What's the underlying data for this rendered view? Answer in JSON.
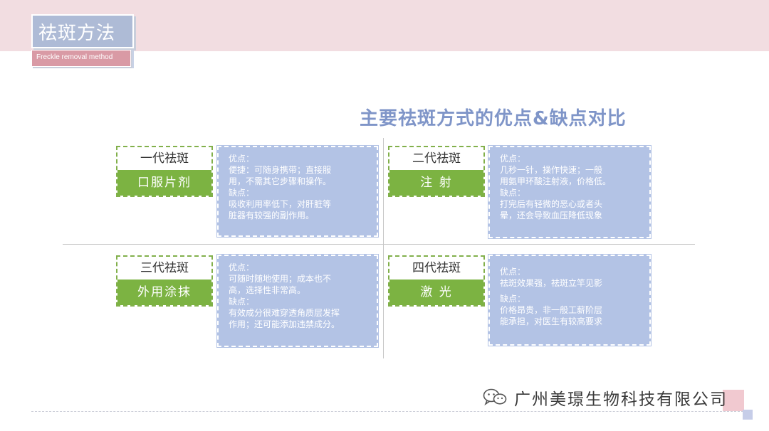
{
  "header": {
    "title": "祛斑方法",
    "subtitle": "Freckle removal method"
  },
  "main_title": "主要祛斑方式的优点&缺点对比",
  "methods": [
    {
      "generation": "一代祛斑",
      "method": "口服片剂",
      "pros_label": "优点：",
      "pros": [
        "便捷：可随身携带；直接服",
        "用，不需其它步骤和操作。"
      ],
      "cons_label": "缺点：",
      "cons": [
        "吸收利用率低下，对肝脏等",
        "脏器有较强的副作用。"
      ]
    },
    {
      "generation": "二代祛斑",
      "method": "注 射",
      "pros_label": "优点：",
      "pros": [
        "几秒一针，操作快速；一般",
        "用氨甲环酸注射液，价格低。"
      ],
      "cons_label": "缺点：",
      "cons": [
        "打完后有轻微的恶心或者头",
        "晕，还会导致血压降低现象"
      ]
    },
    {
      "generation": "三代祛斑",
      "method": "外用涂抹",
      "pros_label": "优点：",
      "pros": [
        "可随时随地使用；成本也不",
        "高，选择性非常高。"
      ],
      "cons_label": "缺点：",
      "cons": [
        "有效成分很难穿透角质层发挥",
        "作用；还可能添加违禁成分。"
      ]
    },
    {
      "generation": "四代祛斑",
      "method": "激 光",
      "pros_label": "优点：",
      "pros": [
        "祛斑效果强，祛斑立竿见影"
      ],
      "cons_label": "缺点：",
      "cons": [
        "价格昂贵，非一般工薪阶层",
        "能承担，对医生有较高要求"
      ]
    }
  ],
  "footer": {
    "company": "广州美璟生物科技有限公司",
    "icon": "wechat-icon"
  },
  "colors": {
    "green": "#7cb342",
    "blue_box": "#b3c3e5",
    "title_blue": "#7f95c8",
    "pink_band": "#f2dde1"
  }
}
